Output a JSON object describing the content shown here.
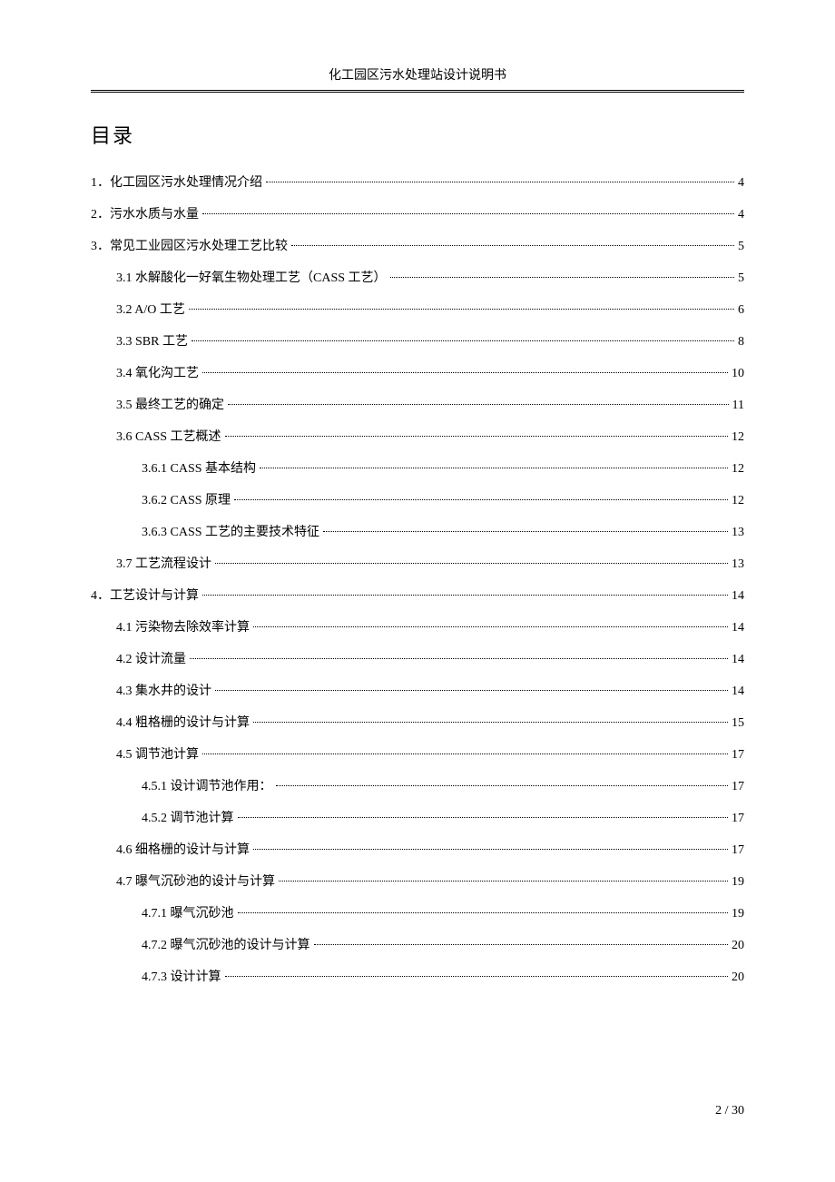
{
  "header": {
    "title": "化工园区污水处理站设计说明书"
  },
  "toc": {
    "title": "目录",
    "entries": [
      {
        "level": 0,
        "label": "1．化工园区污水处理情况介绍",
        "page": "4"
      },
      {
        "level": 0,
        "label": "2．污水水质与水量",
        "page": "4"
      },
      {
        "level": 0,
        "label": "3．常见工业园区污水处理工艺比较",
        "page": "5"
      },
      {
        "level": 1,
        "label": "3.1  水解酸化一好氧生物处理工艺（CASS 工艺）",
        "page": "5"
      },
      {
        "level": 1,
        "label": "3.2 A/O 工艺",
        "page": "6"
      },
      {
        "level": 1,
        "label": "3.3 SBR 工艺",
        "page": "8"
      },
      {
        "level": 1,
        "label": "3.4  氧化沟工艺",
        "page": "10"
      },
      {
        "level": 1,
        "label": "3.5 最终工艺的确定",
        "page": "11"
      },
      {
        "level": 1,
        "label": "3.6 CASS 工艺概述",
        "page": "12"
      },
      {
        "level": 2,
        "label": "3.6.1 CASS 基本结构",
        "page": "12"
      },
      {
        "level": 2,
        "label": "3.6.2 CASS 原理",
        "page": "12"
      },
      {
        "level": 2,
        "label": "3.6.3 CASS 工艺的主要技术特征",
        "page": "13"
      },
      {
        "level": 1,
        "label": "3.7  工艺流程设计",
        "page": "13"
      },
      {
        "level": 0,
        "label": "4．工艺设计与计算",
        "page": "14"
      },
      {
        "level": 1,
        "label": "4.1 污染物去除效率计算",
        "page": "14"
      },
      {
        "level": 1,
        "label": "4.2  设计流量",
        "page": "14"
      },
      {
        "level": 1,
        "label": "4.3  集水井的设计",
        "page": "14"
      },
      {
        "level": 1,
        "label": "4.4 粗格栅的设计与计算",
        "page": "15"
      },
      {
        "level": 1,
        "label": "4.5 调节池计算",
        "page": "17"
      },
      {
        "level": 2,
        "label": "4.5.1 设计调节池作用：",
        "page": "17"
      },
      {
        "level": 2,
        "label": "4.5.2 调节池计算",
        "page": "17"
      },
      {
        "level": 1,
        "label": "4.6 细格栅的设计与计算",
        "page": "17"
      },
      {
        "level": 1,
        "label": "4.7 曝气沉砂池的设计与计算",
        "page": "19"
      },
      {
        "level": 2,
        "label": "4.7.1 曝气沉砂池",
        "page": "19"
      },
      {
        "level": 2,
        "label": "4.7.2 曝气沉砂池的设计与计算",
        "page": "20"
      },
      {
        "level": 2,
        "label": "4.7.3 设计计算",
        "page": "20"
      }
    ]
  },
  "footer": {
    "page_info": "2 / 30"
  }
}
